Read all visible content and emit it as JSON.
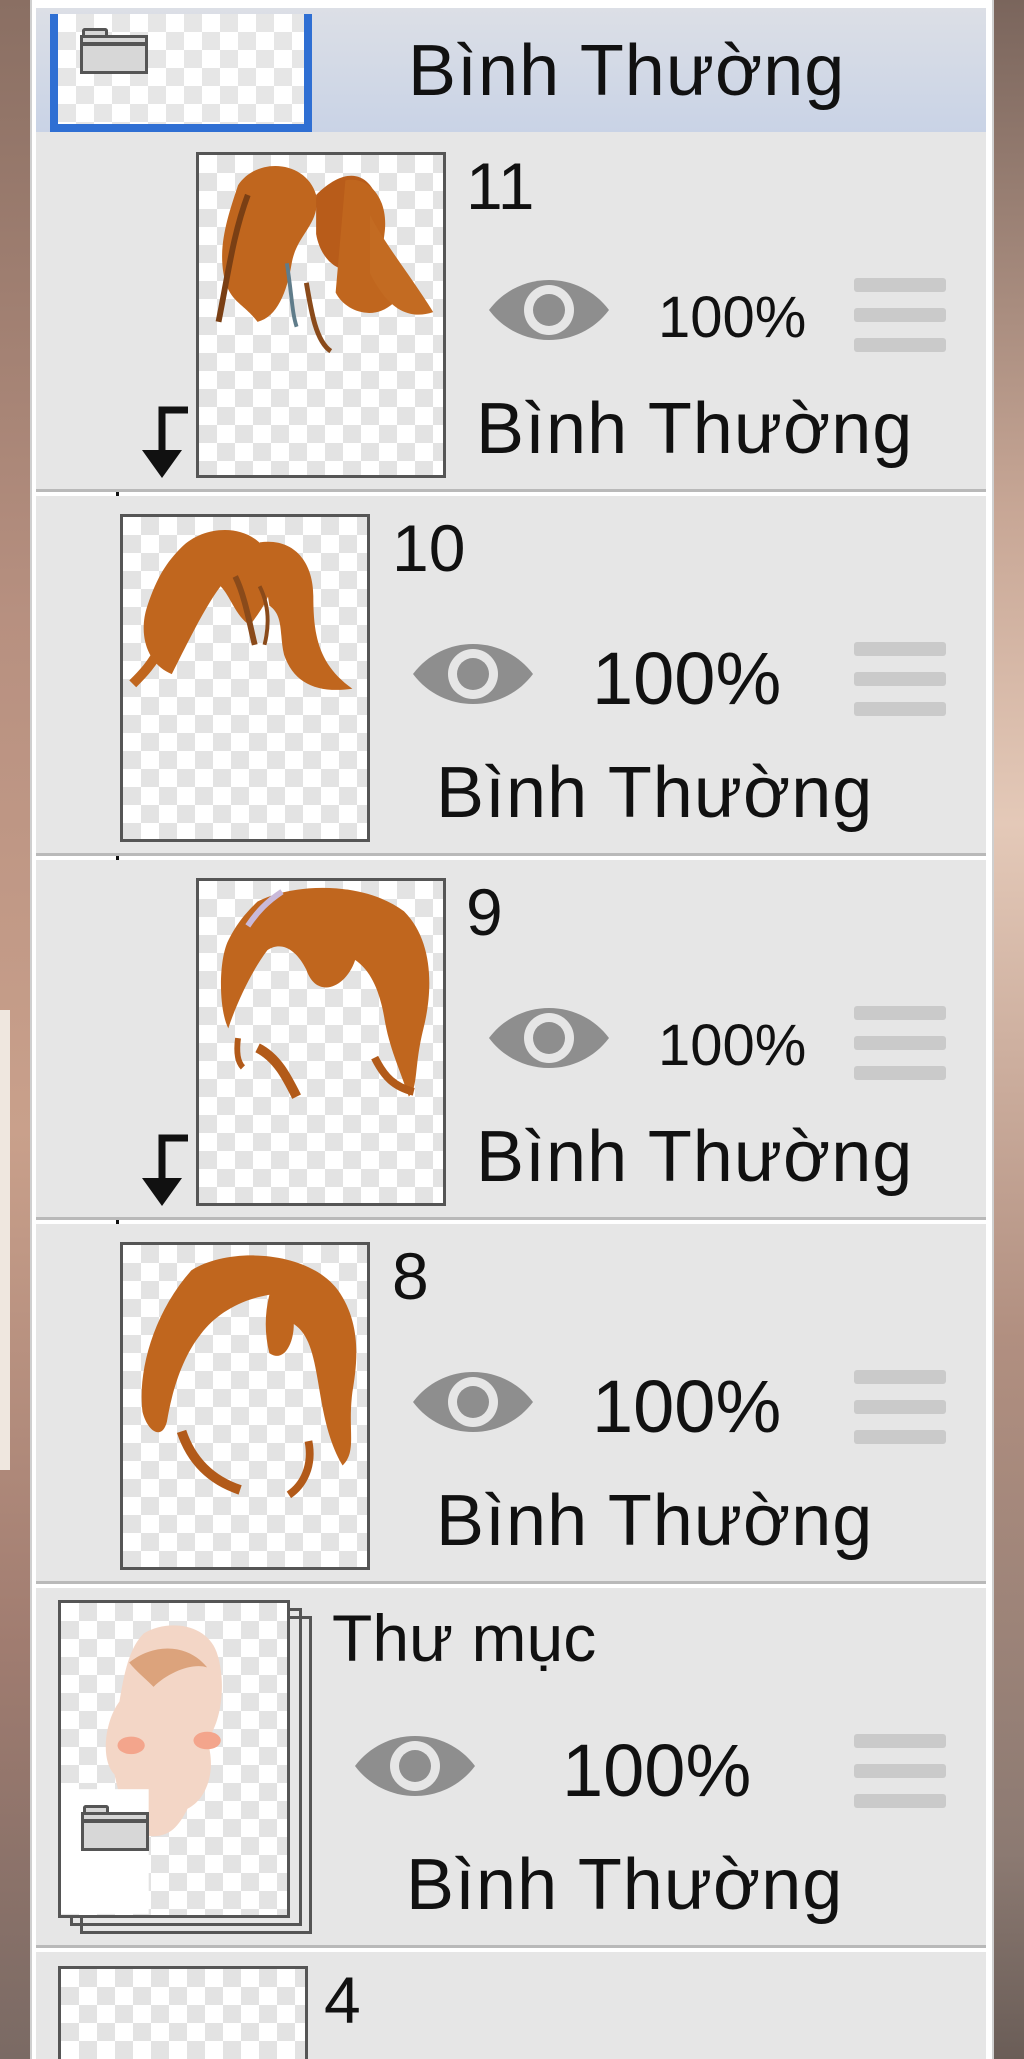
{
  "colors": {
    "selection_border": "#2f6fd3",
    "row_background": "#e6e6e6",
    "hair": "#c0661e",
    "eye_icon": "#8e8e8e"
  },
  "folder_header": {
    "blend_mode": "Bình Thường",
    "icon": "folder-icon"
  },
  "layers": [
    {
      "name": "11",
      "opacity": "100%",
      "blend_mode": "Bình Thường",
      "visibility_icon": "eye-icon",
      "clipped": true
    },
    {
      "name": "10",
      "opacity": "100%",
      "blend_mode": "Bình Thường",
      "visibility_icon": "eye-icon",
      "clipped": false
    },
    {
      "name": "9",
      "opacity": "100%",
      "blend_mode": "Bình Thường",
      "visibility_icon": "eye-icon",
      "clipped": true
    },
    {
      "name": "8",
      "opacity": "100%",
      "blend_mode": "Bình Thường",
      "visibility_icon": "eye-icon",
      "clipped": false
    },
    {
      "name": "Thư mục",
      "opacity": "100%",
      "blend_mode": "Bình Thường",
      "visibility_icon": "eye-icon",
      "type": "folder"
    },
    {
      "name": "4"
    }
  ]
}
